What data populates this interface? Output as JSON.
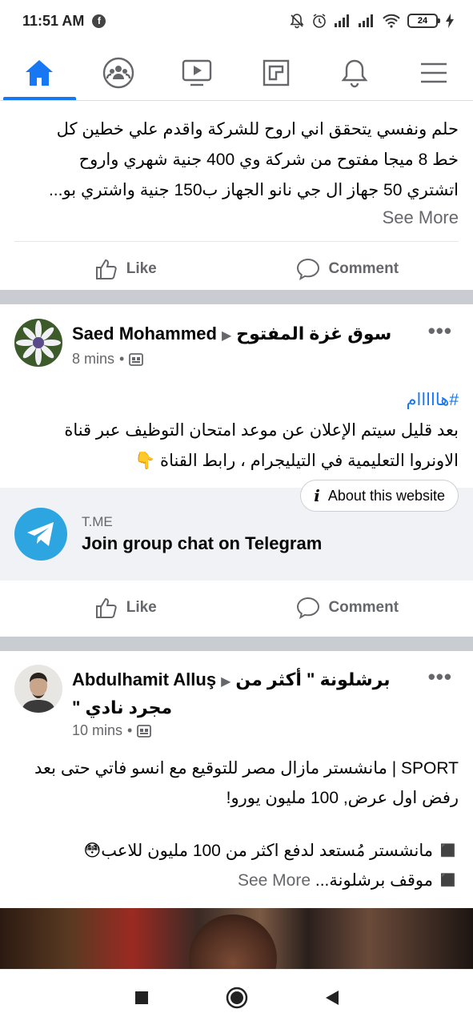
{
  "status_bar": {
    "time": "11:51 AM",
    "battery": "24"
  },
  "post1": {
    "lines": [
      "حلم ونفسي يتحقق اني اروح للشركة واقدم علي خطين كل",
      "خط 8 ميجا مفتوح  من شركة وي 400 جنية شهري واروح",
      "اتشتري 50 جهاز ال جي نانو الجهاز ب150 جنية واشتري بو..."
    ],
    "see_more": "See More",
    "like": "Like",
    "comment": "Comment"
  },
  "post2": {
    "author": "Saed Mohammed",
    "group": "سوق غزة المفتوح",
    "time": "8 mins",
    "more": "•••",
    "hashtag": "#هااااام",
    "lines": [
      "بعد قليل سيتم الإعلان عن موعد امتحان التوظيف عبر قناة",
      "الاونروا التعليمية في التيليجرام ، رابط القناة 👇"
    ],
    "about_site": "About this website",
    "link_domain": "T.ME",
    "link_title": "Join group chat on Telegram",
    "like": "Like",
    "comment": "Comment"
  },
  "post3": {
    "author": "Abdulhamit Alluş",
    "group_line1": "برشلونة \" أكثر من",
    "group_line2": "مجرد نادي \"",
    "time": "10 mins",
    "more": "•••",
    "line1": "SPORT | مانشستر مازال مصر للتوقيع مع انسو فاتي حتى بعد",
    "line2": "رفض اول عرض, 100 مليون يورو!",
    "line3": "◼️ مانشستر مُستعد لدفع اكثر من 100 مليون للاعب😳",
    "line4": "◼️ موقف برشلونة...",
    "see_more": "See More"
  },
  "colors": {
    "brand": "#1877f2",
    "muted": "#65676b",
    "telegram": "#2ca5e0"
  }
}
